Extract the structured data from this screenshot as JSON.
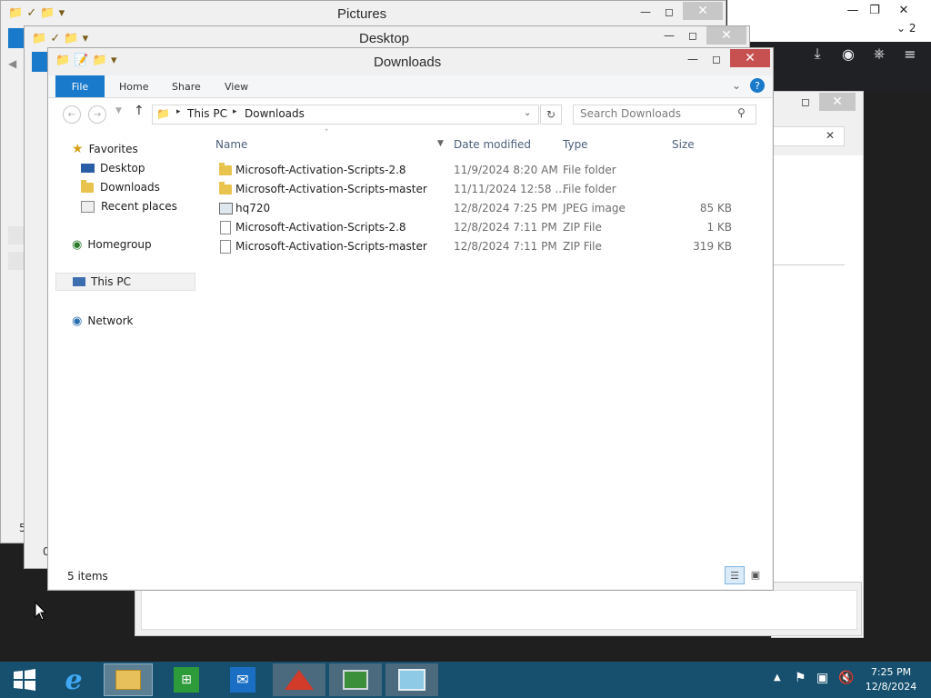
{
  "browser": {
    "tab_count": "2",
    "close_x": "✕"
  },
  "windows": {
    "pictures": {
      "title": "Pictures"
    },
    "desktop": {
      "title": "Desktop"
    },
    "downloads": {
      "title": "Downloads"
    }
  },
  "ribbon": {
    "tabs": [
      "File",
      "Home",
      "Share",
      "View"
    ]
  },
  "address": {
    "breadcrumb": [
      "This PC",
      "Downloads"
    ],
    "search_placeholder": "Search Downloads"
  },
  "nav": {
    "favorites": "Favorites",
    "favorites_items": [
      "Desktop",
      "Downloads",
      "Recent places"
    ],
    "homegroup": "Homegroup",
    "thispc": "This PC",
    "network": "Network"
  },
  "columns": {
    "name": "Name",
    "date": "Date modified",
    "type": "Type",
    "size": "Size"
  },
  "files": [
    {
      "name": "Microsoft-Activation-Scripts-2.8",
      "date": "11/9/2024 8:20 AM",
      "type": "File folder",
      "size": "",
      "icon": "folder-icon"
    },
    {
      "name": "Microsoft-Activation-Scripts-master",
      "date": "11/11/2024 12:58 ...",
      "type": "File folder",
      "size": "",
      "icon": "folder-icon"
    },
    {
      "name": "hq720",
      "date": "12/8/2024 7:25 PM",
      "type": "JPEG image",
      "size": "85 KB",
      "icon": "image-file-icon"
    },
    {
      "name": "Microsoft-Activation-Scripts-2.8",
      "date": "12/8/2024 7:11 PM",
      "type": "ZIP File",
      "size": "1 KB",
      "icon": "zip-file-icon"
    },
    {
      "name": "Microsoft-Activation-Scripts-master",
      "date": "12/8/2024 7:11 PM",
      "type": "ZIP File",
      "size": "319 KB",
      "icon": "zip-file-icon"
    }
  ],
  "status": {
    "items": "5 items"
  },
  "bg_fragments": {
    "left_a": "5",
    "left_b": "0"
  },
  "taskbar": {
    "time": "7:25 PM",
    "date": "12/8/2024"
  },
  "colors": {
    "file_tab": "#1979ca",
    "close_active": "#c75050",
    "taskbar": "#16506e",
    "selection": "#e5f3fb"
  }
}
